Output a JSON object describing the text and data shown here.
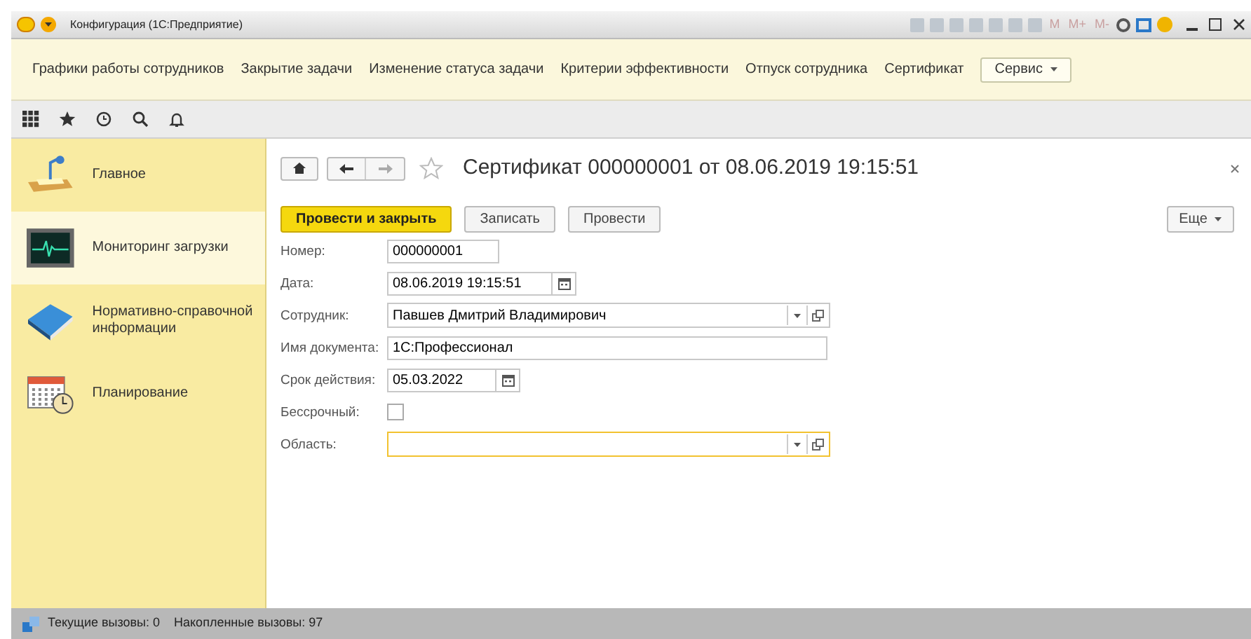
{
  "window": {
    "title": "Конфигурация (1С:Предприятие)",
    "toolbar_texts": [
      "M",
      "M+",
      "M-"
    ]
  },
  "nav": {
    "items": [
      "Графики работы сотрудников",
      "Закрытие задачи",
      "Изменение статуса задачи",
      "Критерии эффективности",
      "Отпуск сотрудника",
      "Сертификат"
    ],
    "menu_button": "Сервис"
  },
  "sidebar": {
    "items": [
      {
        "label": "Главное",
        "kind": "desk",
        "selected": false
      },
      {
        "label": "Мониторинг загрузки",
        "kind": "monitor",
        "selected": true
      },
      {
        "label": "Нормативно-справочной информации",
        "kind": "book",
        "selected": false
      },
      {
        "label": "Планирование",
        "kind": "calendar",
        "selected": false
      }
    ]
  },
  "form": {
    "title": "Сертификат 000000001 от 08.06.2019 19:15:51",
    "favorite": false,
    "buttons": [
      {
        "label": "Провести и закрыть",
        "kind": "primary"
      },
      {
        "label": "Записать",
        "kind": "normal"
      },
      {
        "label": "Провести",
        "kind": "normal"
      }
    ],
    "more_button": "Еще",
    "fields": [
      {
        "label": "Номер:",
        "value": "000000001",
        "kind": "code",
        "focused": false
      },
      {
        "label": "Дата:",
        "value": "08.06.2019 19:15:51",
        "kind": "datetime",
        "focused": false
      },
      {
        "label": "Сотрудник:",
        "value": "Павшев Дмитрий Владимирович",
        "kind": "reference",
        "focused": false
      },
      {
        "label": "Имя документа:",
        "value": "1С:Профессионал",
        "kind": "string",
        "focused": false
      },
      {
        "label": "Срок действия:",
        "value": "05.03.2022",
        "kind": "date",
        "focused": false
      },
      {
        "label": "Бессрочный:",
        "kind": "checkbox",
        "checked": false
      },
      {
        "label": "Область:",
        "kind": "reference",
        "focused": true
      }
    ]
  },
  "status_bar": {
    "current": "Текущие вызовы: 0",
    "accumulated": "Накопленные вызовы: 97"
  }
}
